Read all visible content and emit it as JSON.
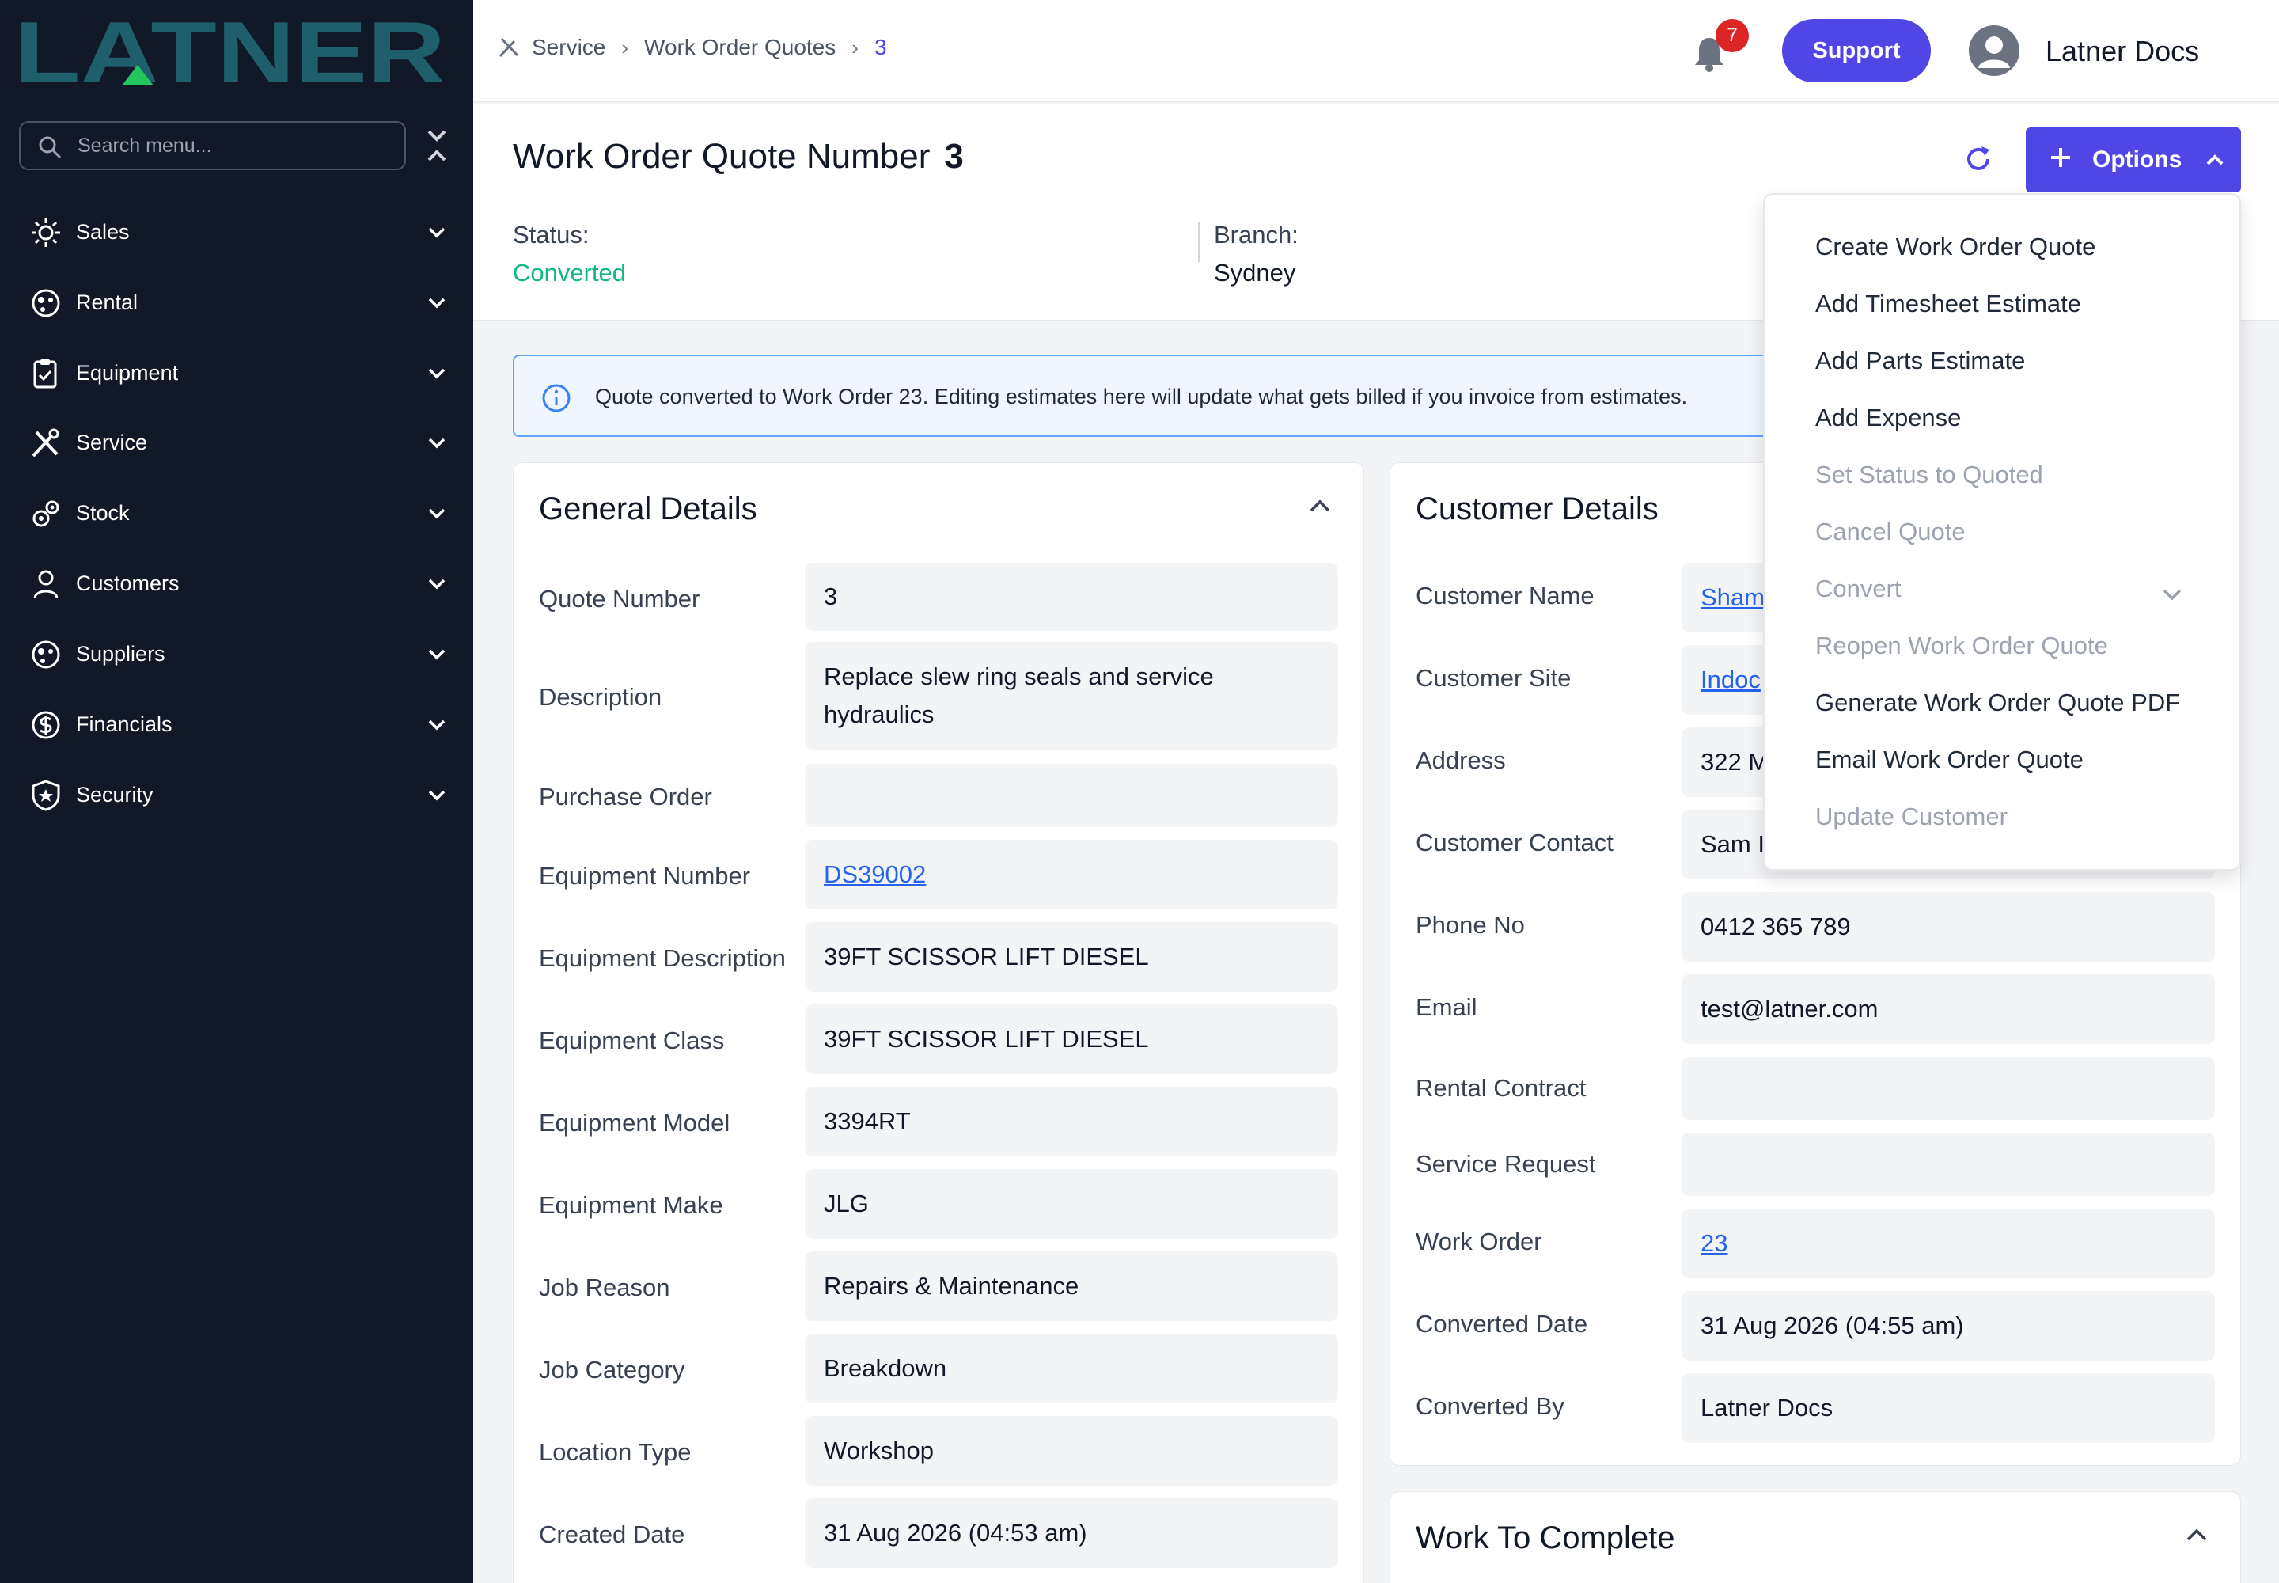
{
  "logo": {
    "text": "LATNER"
  },
  "sidebar": {
    "search_placeholder": "Search menu...",
    "items": [
      {
        "label": "Sales",
        "icon": "sales-icon"
      },
      {
        "label": "Rental",
        "icon": "rental-icon"
      },
      {
        "label": "Equipment",
        "icon": "equipment-icon"
      },
      {
        "label": "Service",
        "icon": "service-icon"
      },
      {
        "label": "Stock",
        "icon": "stock-icon"
      },
      {
        "label": "Customers",
        "icon": "customers-icon"
      },
      {
        "label": "Suppliers",
        "icon": "suppliers-icon"
      },
      {
        "label": "Financials",
        "icon": "financials-icon"
      },
      {
        "label": "Security",
        "icon": "security-icon"
      }
    ]
  },
  "topbar": {
    "breadcrumb": [
      "Service",
      "Work Order Quotes",
      "3"
    ],
    "notifications": "7",
    "support_label": "Support",
    "user_name": "Latner Docs"
  },
  "header": {
    "title": "Work Order Quote Number",
    "number": "3",
    "options_label": "Options",
    "status_label": "Status:",
    "status_value": "Converted",
    "branch_label": "Branch:",
    "branch_value": "Sydney"
  },
  "info_banner": "Quote converted to Work Order 23. Editing estimates here will update what gets billed if you invoice from estimates.",
  "general": {
    "title": "General Details",
    "rows": [
      {
        "label": "Quote Number",
        "value": "3"
      },
      {
        "label": "Description",
        "value": "Replace slew ring seals and service hydraulics"
      },
      {
        "label": "Purchase Order",
        "value": ""
      },
      {
        "label": "Equipment Number",
        "value": "DS39002"
      },
      {
        "label": "Equipment Description",
        "value": "39FT SCISSOR LIFT DIESEL"
      },
      {
        "label": "Equipment Class",
        "value": "39FT SCISSOR LIFT DIESEL"
      },
      {
        "label": "Equipment Model",
        "value": "3394RT"
      },
      {
        "label": "Equipment Make",
        "value": "JLG"
      },
      {
        "label": "Job Reason",
        "value": "Repairs & Maintenance"
      },
      {
        "label": "Job Category",
        "value": "Breakdown"
      },
      {
        "label": "Location Type",
        "value": "Workshop"
      },
      {
        "label": "Created Date",
        "value": "31 Aug 2026 (04:53 am)"
      }
    ]
  },
  "customer": {
    "title": "Customer Details",
    "rows": [
      {
        "label": "Customer Name",
        "value": "Sham"
      },
      {
        "label": "Customer Site",
        "value": "Indoc"
      },
      {
        "label": "Address",
        "value": "322 M"
      },
      {
        "label": "Customer Contact",
        "value": "Sam I"
      },
      {
        "label": "Phone No",
        "value": "0412 365 789"
      },
      {
        "label": "Email",
        "value": "test@latner.com"
      },
      {
        "label": "Rental Contract",
        "value": ""
      },
      {
        "label": "Service Request",
        "value": ""
      },
      {
        "label": "Work Order",
        "value": "23"
      },
      {
        "label": "Converted Date",
        "value": "31 Aug 2026 (04:55 am)"
      },
      {
        "label": "Converted By",
        "value": "Latner Docs"
      }
    ]
  },
  "work": {
    "title": "Work To Complete"
  },
  "options_menu": [
    {
      "label": "Create Work Order Quote",
      "enabled": true
    },
    {
      "label": "Add Timesheet Estimate",
      "enabled": true
    },
    {
      "label": "Add Parts Estimate",
      "enabled": true
    },
    {
      "label": "Add Expense",
      "enabled": true
    },
    {
      "label": "Set Status to Quoted",
      "enabled": false
    },
    {
      "label": "Cancel Quote",
      "enabled": false
    },
    {
      "label": "Convert",
      "enabled": false
    },
    {
      "label": "Reopen Work Order Quote",
      "enabled": false
    },
    {
      "label": "Generate Work Order Quote PDF",
      "enabled": true
    },
    {
      "label": "Email Work Order Quote",
      "enabled": true
    },
    {
      "label": "Update Customer",
      "enabled": false
    }
  ],
  "colors": {
    "accent": "#4f46e5",
    "sidebar": "#111827",
    "status": "#10b981",
    "logo": "#1f5f6b"
  }
}
